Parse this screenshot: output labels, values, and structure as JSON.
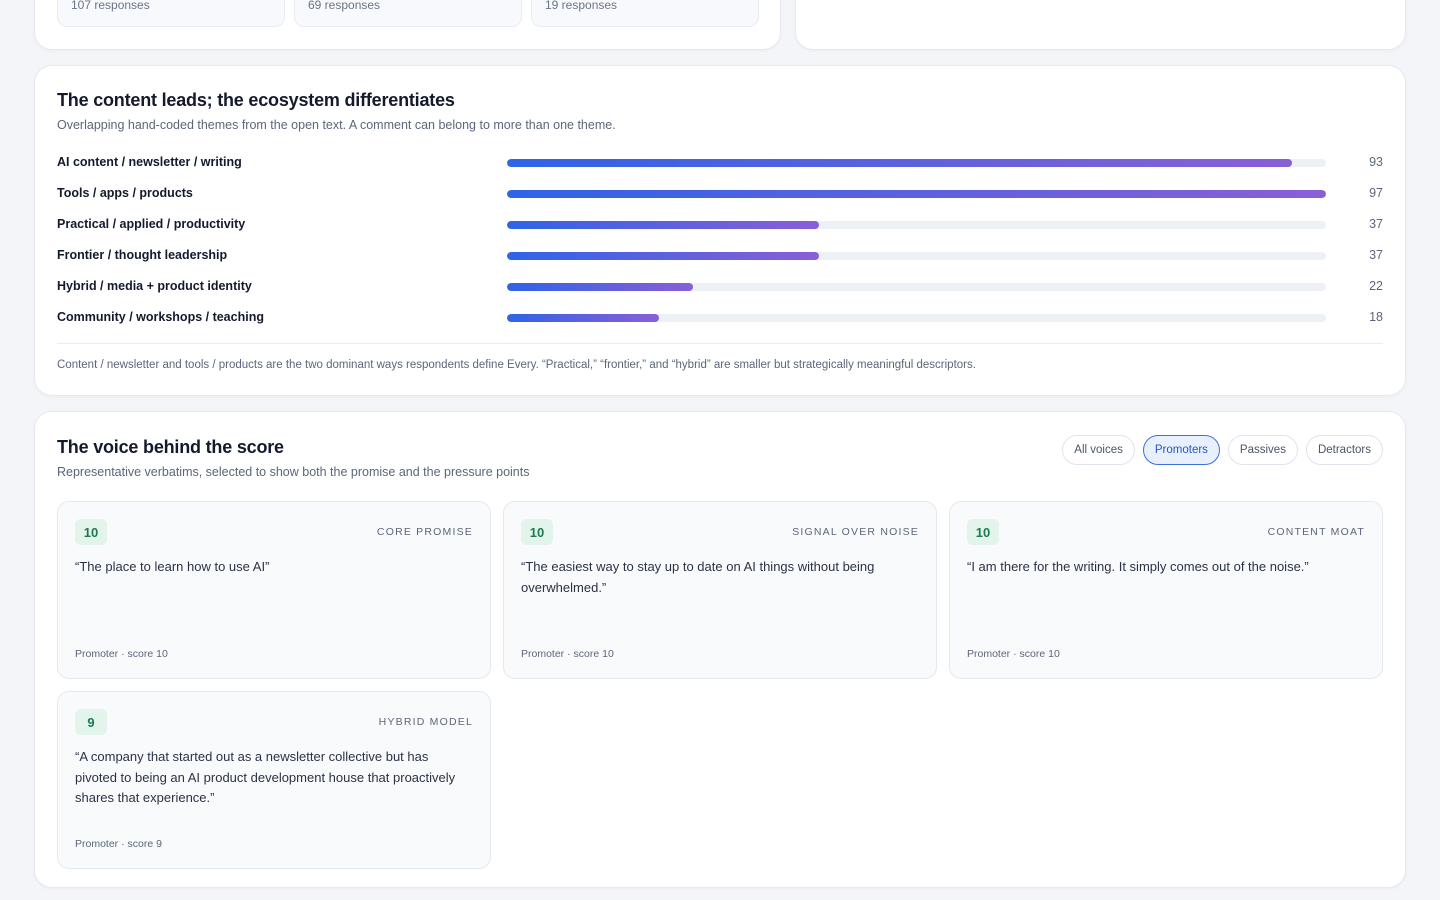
{
  "top": {
    "responses": [
      "107 responses",
      "69 responses",
      "19 responses"
    ]
  },
  "themes": {
    "title": "The content leads; the ecosystem differentiates",
    "subtitle": "Overlapping hand-coded themes from the open text. A comment can belong to more than one theme.",
    "scale_max": 97,
    "items": [
      {
        "label": "AI content / newsletter / writing",
        "value": "93",
        "fraction": 0.959
      },
      {
        "label": "Tools / apps / products",
        "value": "97",
        "fraction": 1.0
      },
      {
        "label": "Practical / applied / productivity",
        "value": "37",
        "fraction": 0.381
      },
      {
        "label": "Frontier / thought leadership",
        "value": "37",
        "fraction": 0.381
      },
      {
        "label": "Hybrid / media + product identity",
        "value": "22",
        "fraction": 0.227
      },
      {
        "label": "Community / workshops / teaching",
        "value": "18",
        "fraction": 0.186
      }
    ],
    "footnote": "Content / newsletter and tools / products are the two dominant ways respondents define Every. “Practical,” “frontier,” and “hybrid” are smaller but strategically meaningful descriptors."
  },
  "voice": {
    "title": "The voice behind the score",
    "subtitle": "Representative verbatims, selected to show both the promise and the pressure points",
    "filters": [
      {
        "label": "All voices",
        "active": false
      },
      {
        "label": "Promoters",
        "active": true
      },
      {
        "label": "Passives",
        "active": false
      },
      {
        "label": "Detractors",
        "active": false
      }
    ],
    "quotes": [
      {
        "score": "10",
        "tag": "CORE PROMISE",
        "text": "“The place to learn how to use AI”",
        "meta": "Promoter · score 10"
      },
      {
        "score": "10",
        "tag": "SIGNAL OVER NOISE",
        "text": "“The easiest way to stay up to date on AI things without being overwhelmed.”",
        "meta": "Promoter · score 10"
      },
      {
        "score": "10",
        "tag": "CONTENT MOAT",
        "text": "“I am there for the writing. It simply comes out of the noise.”",
        "meta": "Promoter · score 10"
      },
      {
        "score": "9",
        "tag": "HYBRID MODEL",
        "text": "“A company that started out as a newsletter collective but has pivoted to being an AI product development house that proactively shares that experience.”",
        "meta": "Promoter · score 9"
      }
    ]
  },
  "colors": {
    "bar_start": "#2f63e8",
    "bar_end": "#8a5fd6",
    "badge_bg": "#e3f4ec",
    "badge_text": "#1b7a50",
    "active_pill": "#3b6fe0"
  }
}
